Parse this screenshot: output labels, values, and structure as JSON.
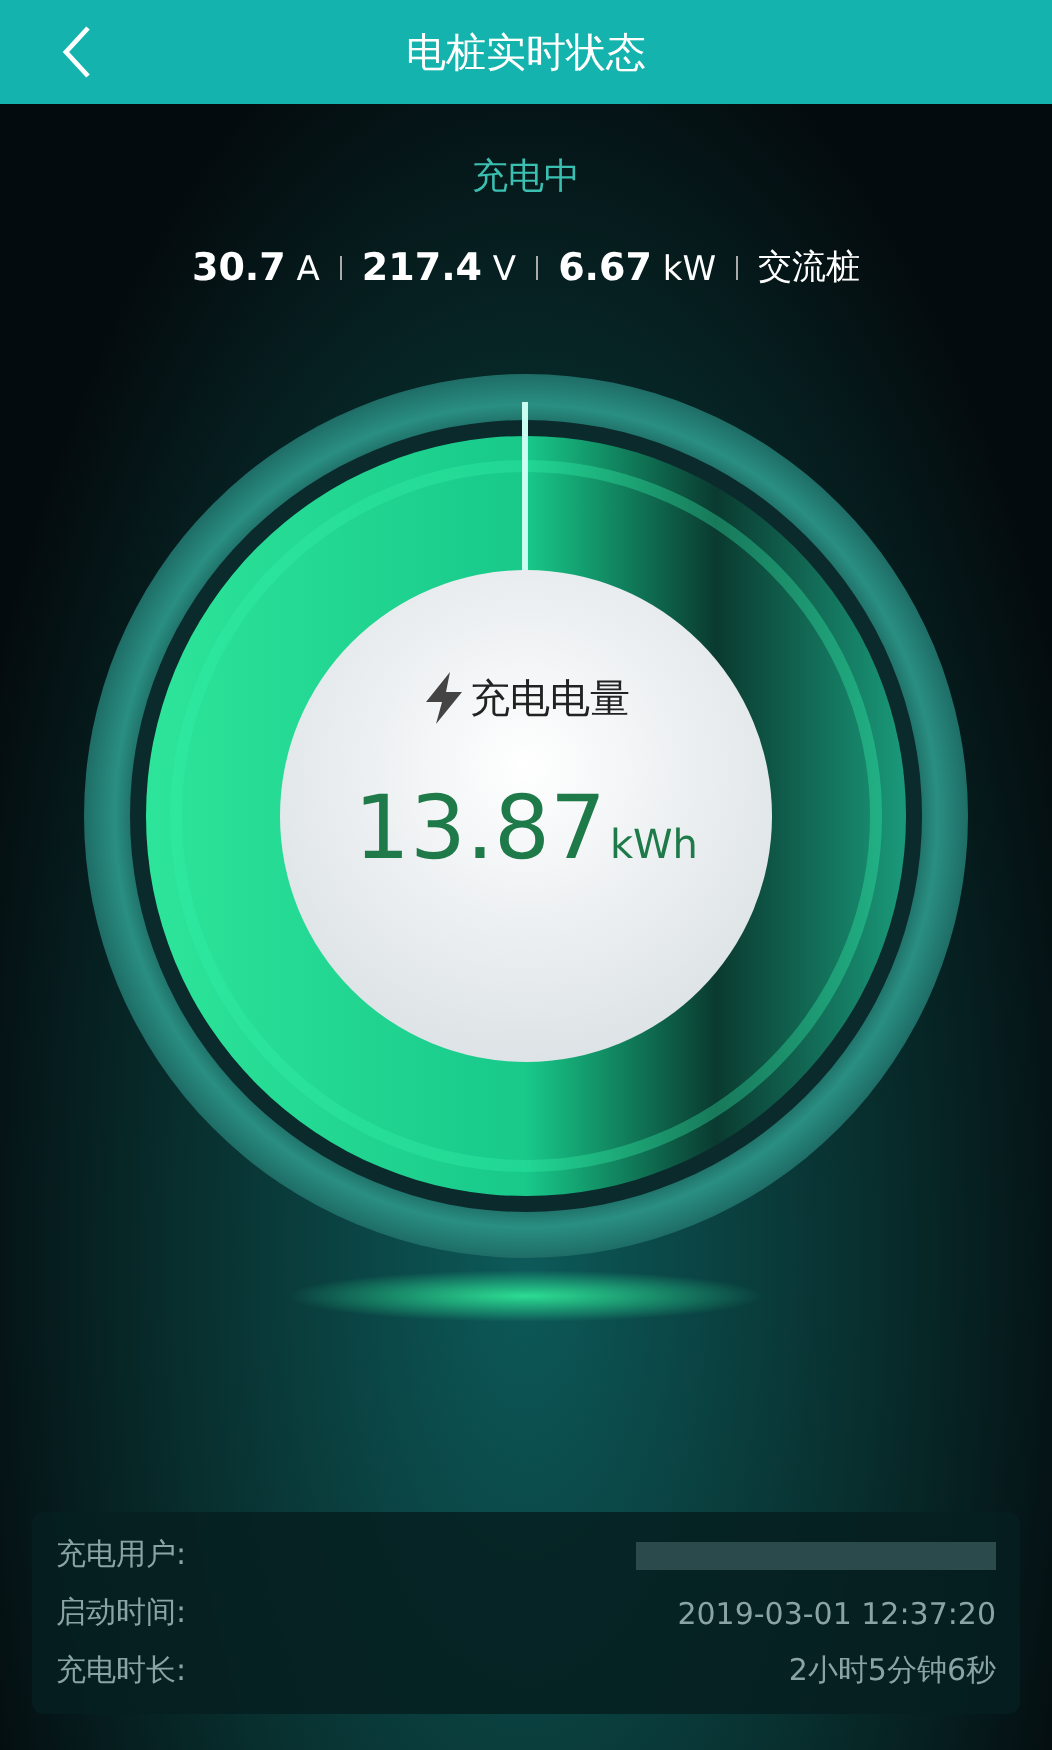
{
  "header": {
    "title": "电桩实时状态"
  },
  "status": "充电中",
  "stats": [
    {
      "value": "30.7",
      "unit": "A"
    },
    {
      "value": "217.4",
      "unit": "V"
    },
    {
      "value": "6.67",
      "unit": "kW"
    },
    {
      "value": "交流桩"
    }
  ],
  "gauge": {
    "label": "充电电量",
    "value": "13.87",
    "unit": "kWh"
  },
  "info": [
    {
      "label": "充电用户:",
      "redacted": true
    },
    {
      "label": "启动时间:",
      "value": "2019-03-01 12:37:20",
      "redacted": false
    },
    {
      "label": "充电时长:",
      "value": "2小时5分钟6秒",
      "redacted": false
    }
  ]
}
